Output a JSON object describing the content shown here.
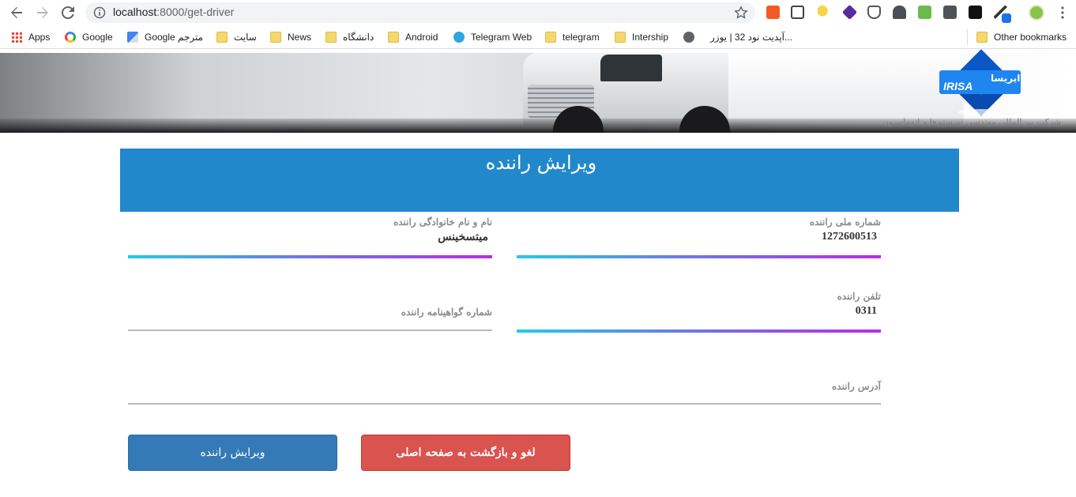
{
  "browser": {
    "url_host": "localhost",
    "url_path": ":8000/get-driver",
    "bookmarks": [
      {
        "label": "Apps",
        "icon": "apps-grid-icon"
      },
      {
        "label": "Google",
        "icon": "google-icon"
      },
      {
        "label": "Google مترجم",
        "icon": "translate-icon"
      },
      {
        "label": "سایت",
        "icon": "folder-icon"
      },
      {
        "label": "News",
        "icon": "folder-icon"
      },
      {
        "label": "دانشگاه",
        "icon": "folder-icon"
      },
      {
        "label": "Android",
        "icon": "folder-icon"
      },
      {
        "label": "Telegram Web",
        "icon": "telegram-icon"
      },
      {
        "label": "telegram",
        "icon": "folder-icon"
      },
      {
        "label": "Intership",
        "icon": "folder-icon"
      },
      {
        "label": "آپدیت نود 32 | یوزر...",
        "icon": "globe-icon"
      },
      {
        "label": "Other bookmarks",
        "icon": "folder-icon"
      }
    ],
    "colors": {
      "omnibox_bg": "#f1f3f4",
      "folder": "#f5d76e"
    }
  },
  "banner": {
    "logo_latin": "IRISA",
    "logo_persian": "ایریسا",
    "caption": "شرکت بین‌المللی مهندسی سیستم‌ها و اتوماسیون",
    "colors": {
      "logo_blue": "#1f86f0"
    }
  },
  "form": {
    "title": "ویرایش راننده",
    "fields": {
      "national_id": {
        "label": "شماره ملی راننده",
        "value": "1272600513"
      },
      "full_name": {
        "label": "نام و نام خانوادگی راننده",
        "value": "میتسخینس"
      },
      "phone": {
        "label": "تلفن راننده",
        "value": "0311"
      },
      "license": {
        "label": "شماره گواهینامه راننده",
        "value": ""
      },
      "address": {
        "label": "آدرس راننده",
        "value": ""
      }
    },
    "buttons": {
      "edit": "ویرایش راننده",
      "cancel": "لغو و بازگشت به صفحه اصلی"
    },
    "colors": {
      "header": "#2288cc",
      "edit_button": "#337ab7",
      "cancel_button": "#d9534f",
      "underline_start": "#22cbe6",
      "underline_end": "#b82ee8"
    }
  }
}
